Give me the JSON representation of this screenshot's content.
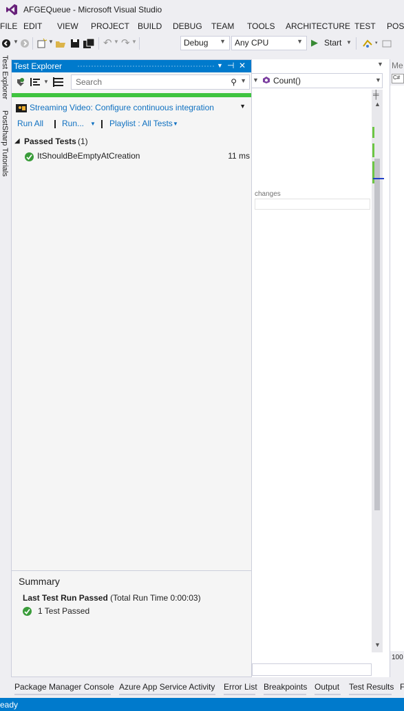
{
  "window": {
    "title": "AFGEQueue - Microsoft Visual Studio"
  },
  "menu": [
    "FILE",
    "EDIT",
    "VIEW",
    "PROJECT",
    "BUILD",
    "DEBUG",
    "TEAM",
    "TOOLS",
    "ARCHITECTURE",
    "TEST",
    "POST"
  ],
  "toolbar": {
    "configuration": "Debug",
    "platform": "Any CPU",
    "start_label": "Start"
  },
  "side_tabs": [
    "Test Explorer",
    "PostSharp Tutorials"
  ],
  "test_explorer": {
    "title": "Test Explorer",
    "search_placeholder": "Search",
    "progress": 1.0,
    "progress_color": "#3fc43f",
    "project": "Streaming Video: Configure continuous integration",
    "run_all": "Run All",
    "run": "Run...",
    "playlist": "Playlist : All Tests",
    "group": {
      "label": "Passed Tests",
      "count": "(1)"
    },
    "tests": [
      {
        "name": "ItShouldBeEmptyAtCreation",
        "time": "11 ms",
        "status": "passed"
      }
    ],
    "summary": {
      "title": "Summary",
      "result_bold": "Last Test Run Passed",
      "result_detail": "(Total Run Time 0:00:03)",
      "passed": "1 Test Passed"
    }
  },
  "editor": {
    "member": "Count()",
    "changes_label": "changes"
  },
  "right_panel": {
    "title": "Me",
    "zoom": "100"
  },
  "bottom_tabs": [
    "Package Manager Console",
    "Azure App Service Activity",
    "Error List",
    "Breakpoints",
    "Output",
    "Test Results",
    "F"
  ],
  "status": {
    "text": "eady"
  },
  "colors": {
    "accent": "#007acc",
    "link": "#0e70c0",
    "passed": "#3a9c3a"
  }
}
